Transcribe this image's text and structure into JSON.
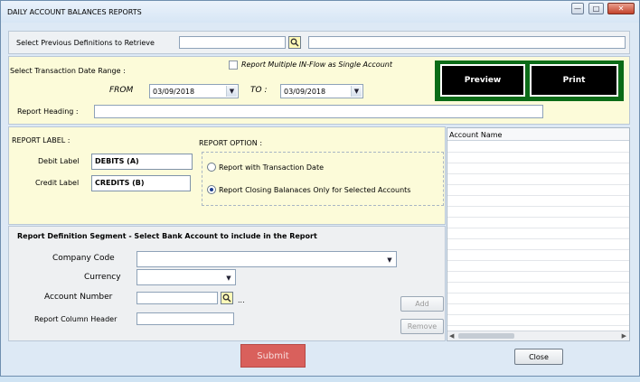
{
  "window": {
    "title": "DAILY ACCOUNT BALANCES REPORTS",
    "controls": {
      "minimize": "—",
      "maximize": "□",
      "close": "✕"
    }
  },
  "retrieve": {
    "label": "Select Previous Definitions to Retrieve",
    "definition_value": "",
    "description_value": ""
  },
  "date_range": {
    "label": "Select Transaction Date Range :",
    "multiple_inflow_label": "Report Multiple IN-Flow as Single Account",
    "multiple_inflow_checked": false,
    "from_label": "FROM",
    "from_value": "03/09/2018",
    "to_label": "TO :",
    "to_value": "03/09/2018",
    "heading_label": "Report Heading :",
    "heading_value": ""
  },
  "actions": {
    "preview_label": "Preview",
    "print_label": "Print"
  },
  "report_label": {
    "section_title": "REPORT LABEL :",
    "debit_label": "Debit Label",
    "debit_value": "DEBITS (A)",
    "credit_label": "Credit Label",
    "credit_value": "CREDITS (B)"
  },
  "report_option": {
    "section_title": "REPORT OPTION :",
    "options": [
      {
        "label": "Report with Transaction Date",
        "selected": false
      },
      {
        "label": "Report Closing Balanaces Only for Selected Accounts",
        "selected": true
      }
    ]
  },
  "segment": {
    "title": "Report Definition Segment - Select Bank Account to include in the Report",
    "company_code_label": "Company Code",
    "company_code_value": "",
    "currency_label": "Currency",
    "currency_value": "",
    "account_number_label": "Account Number",
    "account_number_value": "",
    "ellipsis": "...",
    "column_header_label": "Report Column Header",
    "column_header_value": "",
    "add_label": "Add",
    "remove_label": "Remove"
  },
  "account_grid": {
    "column_header": "Account Name",
    "rows": 17
  },
  "footer": {
    "submit_label": "Submit",
    "close_label": "Close"
  },
  "colors": {
    "yellow_panel": "#fcfbd9",
    "action_frame": "#0b6b17",
    "submit_bg": "#d9605c",
    "search_icon_bg": "#fff9b8"
  }
}
